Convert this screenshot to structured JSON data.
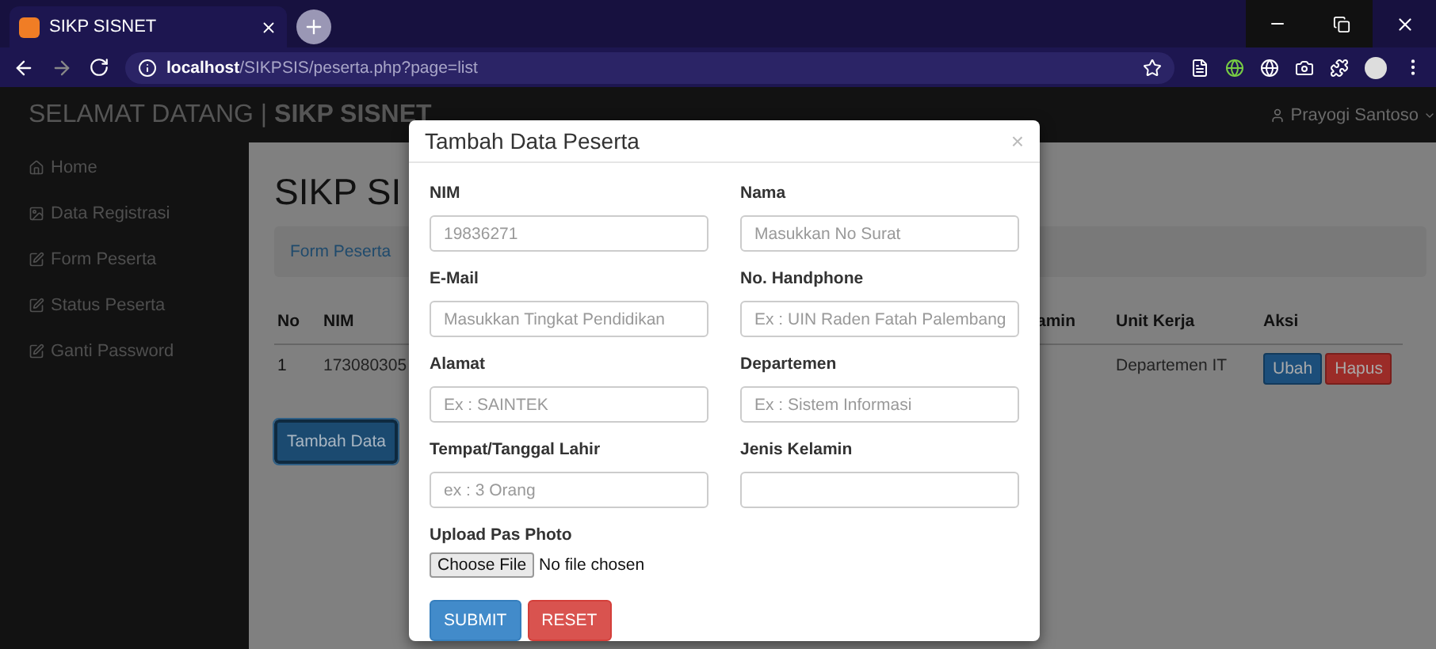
{
  "browser": {
    "tab_title": "SIKP SISNET",
    "url_host": "localhost",
    "url_path": "/SIKPSIS/peserta.php?page=list"
  },
  "navbar": {
    "greeting": "SELAMAT DATANG |",
    "brand": "SIKP SISNET",
    "user": "Prayogi Santoso"
  },
  "sidebar": {
    "items": [
      {
        "label": "Home",
        "kind": "home"
      },
      {
        "label": "Data Registrasi",
        "kind": "data"
      },
      {
        "label": "Form Peserta",
        "kind": "form"
      },
      {
        "label": "Status Peserta",
        "kind": "form"
      },
      {
        "label": "Ganti Password",
        "kind": "form"
      }
    ]
  },
  "page": {
    "heading": "SIKP SI",
    "breadcrumb": "Form Peserta",
    "table": {
      "columns": [
        "No",
        "NIM",
        "amin",
        "Unit Kerja",
        "Aksi"
      ],
      "rows": [
        {
          "no": "1",
          "nim": "173080305",
          "unit_kerja": "Departemen IT",
          "actions": [
            {
              "label": "Ubah",
              "kind": "edit"
            },
            {
              "label": "Hapus",
              "kind": "delete"
            }
          ]
        }
      ]
    },
    "add_button": "Tambah Data"
  },
  "modal": {
    "title": "Tambah Data Peserta",
    "close": "×",
    "fields": [
      {
        "label": "NIM",
        "placeholder": "19836271"
      },
      {
        "label": "Nama",
        "placeholder": "Masukkan No Surat"
      },
      {
        "label": "E-Mail",
        "placeholder": "Masukkan Tingkat Pendidikan"
      },
      {
        "label": "No. Handphone",
        "placeholder": "Ex : UIN Raden Fatah Palembang"
      },
      {
        "label": "Alamat",
        "placeholder": "Ex : SAINTEK"
      },
      {
        "label": "Departemen",
        "placeholder": "Ex : Sistem Informasi"
      },
      {
        "label": "Tempat/Tanggal Lahir",
        "placeholder": "ex : 3 Orang"
      },
      {
        "label": "Jenis Kelamin"
      }
    ],
    "upload": {
      "label": "Upload Pas Photo",
      "button": "Choose File",
      "status": "No file chosen"
    },
    "buttons": [
      {
        "label": "SUBMIT",
        "kind": "primary"
      },
      {
        "label": "RESET",
        "kind": "danger"
      }
    ]
  }
}
